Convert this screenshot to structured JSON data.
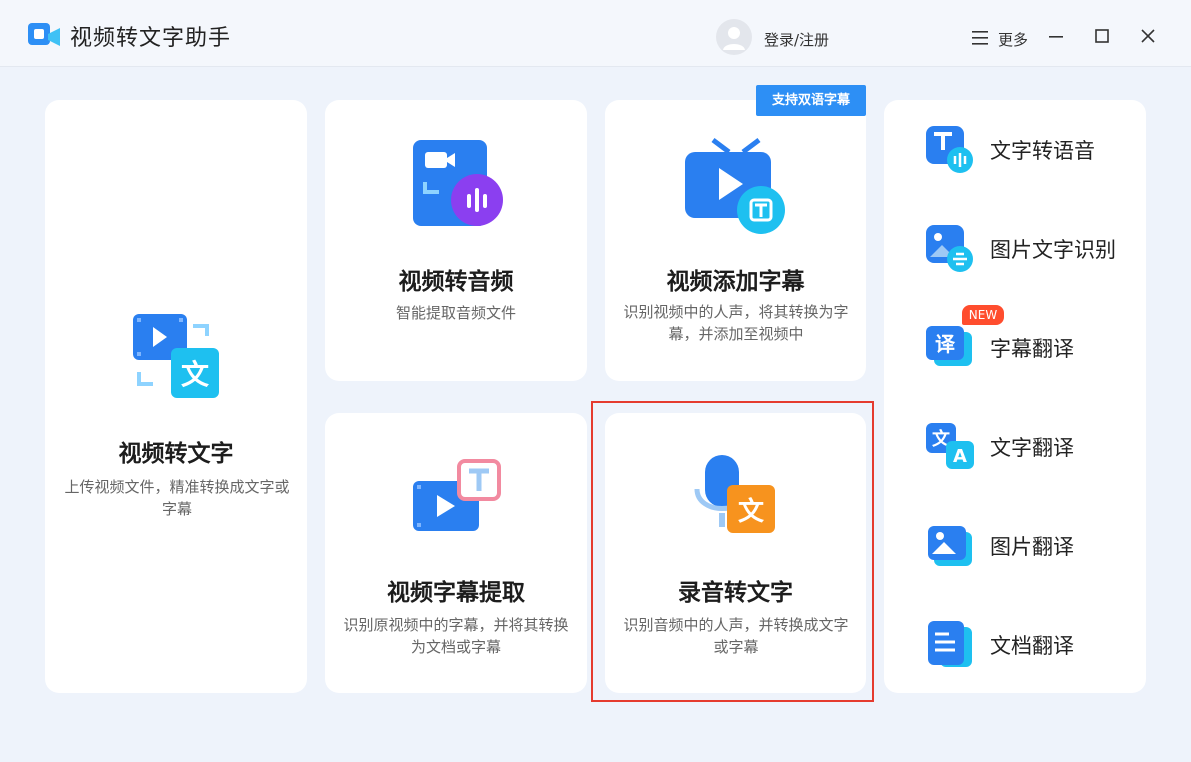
{
  "app": {
    "title": "视频转文字助手",
    "login_label": "登录/注册",
    "more_label": "更多"
  },
  "cards": {
    "video_to_text": {
      "title": "视频转文字",
      "desc": "上传视频文件，精准转换成文字或字幕"
    },
    "video_to_audio": {
      "title": "视频转音频",
      "desc": "智能提取音频文件"
    },
    "add_subtitles": {
      "title": "视频添加字幕",
      "desc": "识别视频中的人声，将其转换为字幕，并添加至视频中",
      "badge": "支持双语字幕"
    },
    "extract_subtitles": {
      "title": "视频字幕提取",
      "desc": "识别原视频中的字幕，并将其转换为文档或字幕"
    },
    "record_to_text": {
      "title": "录音转文字",
      "desc": "识别音频中的人声，并转换成文字或字幕"
    }
  },
  "side_items": [
    {
      "label": "文字转语音",
      "icon": "text-to-speech-icon"
    },
    {
      "label": "图片文字识别",
      "icon": "image-ocr-icon"
    },
    {
      "label": "字幕翻译",
      "icon": "subtitle-translate-icon",
      "badge": "NEW"
    },
    {
      "label": "文字翻译",
      "icon": "text-translate-icon"
    },
    {
      "label": "图片翻译",
      "icon": "image-translate-icon"
    },
    {
      "label": "文档翻译",
      "icon": "document-translate-icon"
    }
  ],
  "colors": {
    "accent": "#2d8ff5",
    "highlight": "#e53b2f",
    "new_badge": "#ff4d2e",
    "background": "#eef3fb"
  }
}
